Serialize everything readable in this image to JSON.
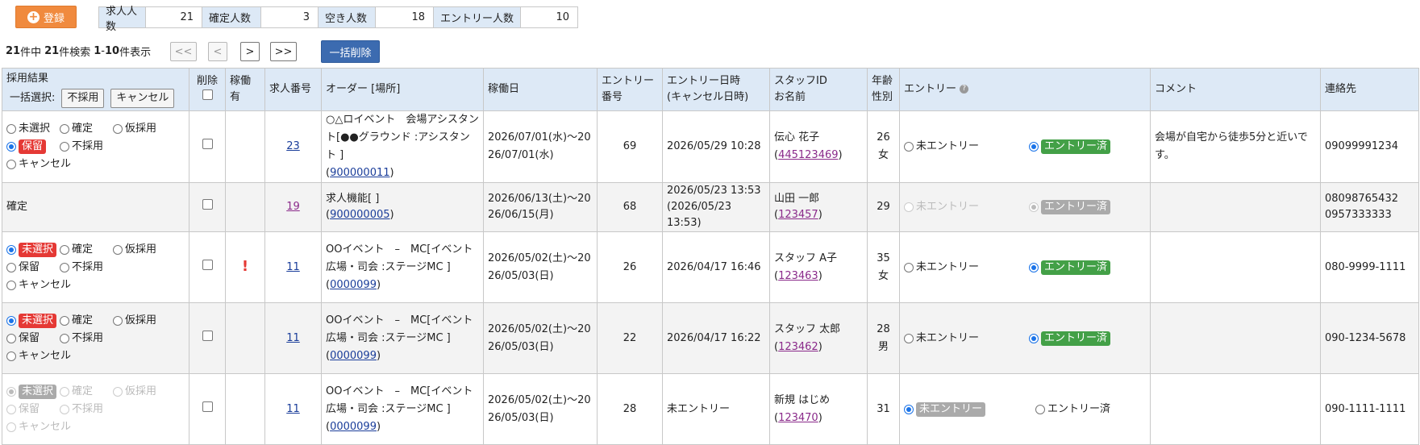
{
  "toolbar": {
    "register_label": "登録"
  },
  "stats": [
    {
      "label": "求人人数",
      "value": "21"
    },
    {
      "label": "確定人数",
      "value": "3"
    },
    {
      "label": "空き人数",
      "value": "18"
    },
    {
      "label": "エントリー人数",
      "value": "10"
    }
  ],
  "pager": {
    "total": "21",
    "total_suffix": "件中",
    "found": "21",
    "found_suffix": "件検索",
    "from": "1",
    "sep": "- ",
    "to": "10",
    "to_suffix": "件表示",
    "first": "<<",
    "prev": "<",
    "next": ">",
    "last": ">>",
    "bulk_delete": "一括削除"
  },
  "headers": {
    "result": "採用結果",
    "bulk_select": "一括選択:",
    "btn_reject": "不採用",
    "btn_cancel": "キャンセル",
    "delete": "削除",
    "working": "稼働有",
    "job_no": "求人番号",
    "order": "オーダー [場所]",
    "work_day": "稼働日",
    "entry_no": "エントリー番号",
    "entry_dt": "エントリー日時",
    "entry_dt2": "(キャンセル日時)",
    "staff_id": "スタッフID",
    "staff_name": "お名前",
    "age": "年齢",
    "sex": "性別",
    "entry": "エントリー",
    "comment": "コメント",
    "contact": "連絡先"
  },
  "options": {
    "unselected": "未選択",
    "confirmed": "確定",
    "provisional": "仮採用",
    "hold": "保留",
    "rejected": "不採用",
    "cancel": "キャンセル",
    "not_entered": "未エントリー",
    "entered": "エントリー済"
  },
  "rows": [
    {
      "result_text": "",
      "job_no": "23",
      "order": "○△ロイベント　会場アシスタント[●●グラウンド :アシスタント ]",
      "order_id": "900000011",
      "work_day": "2026/07/01(水)～2026/07/01(水)",
      "entry_no": "69",
      "entry_dt": "2026/05/29 10:28",
      "entry_dt2": "",
      "staff_name": "伝心 花子",
      "staff_id": "445123469",
      "age": "26",
      "sex": "女",
      "comment": "会場が自宅から徒歩5分と近いです。",
      "contact": "09099991234",
      "contact2": "",
      "excl": ""
    },
    {
      "result_text": "確定",
      "job_no": "19",
      "order": "求人機能[ ]",
      "order_id": "900000005",
      "work_day": "2026/06/13(土)～2026/06/15(月)",
      "entry_no": "68",
      "entry_dt": "2026/05/23 13:53",
      "entry_dt2": "(2026/05/23 13:53)",
      "staff_name": "山田 一郎",
      "staff_id": "123457",
      "age": "29",
      "sex": "",
      "comment": "",
      "contact": "08098765432",
      "contact2": "0957333333",
      "excl": ""
    },
    {
      "result_text": "",
      "job_no": "11",
      "order": "OOイベント　–　MC[イベント広場・司会 :ステージMC ]",
      "order_id": "0000099",
      "work_day": "2026/05/02(土)～2026/05/03(日)",
      "entry_no": "26",
      "entry_dt": "2026/04/17 16:46",
      "entry_dt2": "",
      "staff_name": "スタッフ A子",
      "staff_id": "123463",
      "age": "35",
      "sex": "女",
      "comment": "",
      "contact": "080-9999-1111",
      "contact2": "",
      "excl": "!"
    },
    {
      "result_text": "",
      "job_no": "11",
      "order": "OOイベント　–　MC[イベント広場・司会 :ステージMC ]",
      "order_id": "0000099",
      "work_day": "2026/05/02(土)～2026/05/03(日)",
      "entry_no": "22",
      "entry_dt": "2026/04/17 16:22",
      "entry_dt2": "",
      "staff_name": "スタッフ 太郎",
      "staff_id": "123462",
      "age": "28",
      "sex": "男",
      "comment": "",
      "contact": "090-1234-5678",
      "contact2": "",
      "excl": ""
    },
    {
      "result_text": "",
      "job_no": "11",
      "order": "OOイベント　–　MC[イベント広場・司会 :ステージMC ]",
      "order_id": "0000099",
      "work_day": "2026/05/02(土)～2026/05/03(日)",
      "entry_no": "28",
      "entry_dt": "未エントリー",
      "entry_dt2": "",
      "staff_name": "新規 はじめ",
      "staff_id": "123470",
      "age": "31",
      "sex": "",
      "comment": "",
      "contact": "090-1111-1111",
      "contact2": "",
      "excl": ""
    }
  ]
}
